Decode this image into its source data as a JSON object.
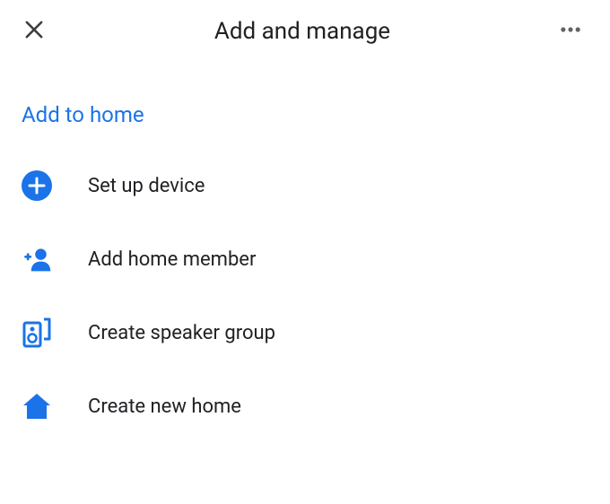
{
  "header": {
    "title": "Add and manage"
  },
  "section": {
    "label": "Add to home"
  },
  "menu": {
    "items": [
      {
        "label": "Set up device",
        "icon": "plus-circle-icon"
      },
      {
        "label": "Add home member",
        "icon": "add-person-icon"
      },
      {
        "label": "Create speaker group",
        "icon": "speaker-group-icon"
      },
      {
        "label": "Create new home",
        "icon": "home-icon"
      }
    ]
  },
  "colors": {
    "accent": "#1a73e8",
    "iconBlue": "#1a73e8",
    "text": "#202124"
  }
}
